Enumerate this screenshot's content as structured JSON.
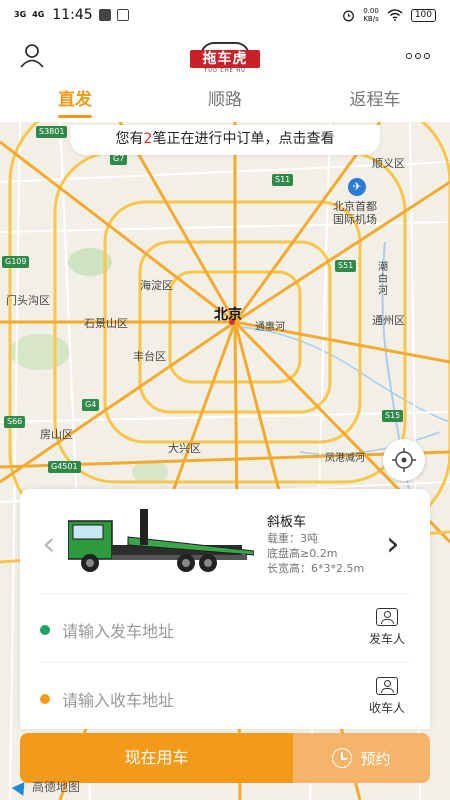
{
  "status_bar": {
    "signal_1": "3G",
    "signal_2": "4G",
    "time": "11:45",
    "net_speed_value": "0.00",
    "net_speed_unit": "KB/s",
    "battery": "100"
  },
  "header": {
    "logo_text": "拖车虎",
    "logo_sub": "TUO CHE HU",
    "user_icon": "user-icon",
    "more_icon": "more-icon"
  },
  "tabs": [
    {
      "label": "直发",
      "active": true
    },
    {
      "label": "顺路",
      "active": false
    },
    {
      "label": "返程车",
      "active": false
    }
  ],
  "notice": {
    "prefix": "您有",
    "count": "2",
    "suffix": "笔正在进行中订单，点击查看"
  },
  "map": {
    "labels": {
      "beijing": "北京",
      "haidian": "海淀区",
      "shijingshan": "石景山区",
      "fengtai": "丰台区",
      "mentougou": "门头沟区",
      "fangshan": "房山区",
      "daxing": "大兴区",
      "tongzhou": "通州区",
      "shunyi": "顺义区",
      "airport": "北京首都\n国际机场",
      "tonghuihe": "通惠河",
      "chaobaihe": "潮白河",
      "fenggangjianhe": "凤港减河"
    },
    "road_tags": [
      "S3801",
      "G7",
      "S11",
      "G109",
      "S51",
      "G4",
      "S66",
      "G4501",
      "S15"
    ],
    "attribution": "高德地图"
  },
  "vehicle": {
    "name": "斜板车",
    "load": "载重：3吨",
    "chassis": "底盘高≥0.2m",
    "size": "长宽高：6*3*2.5m",
    "prev_arrow": "‹",
    "next_arrow": "›"
  },
  "departure": {
    "placeholder": "请输入发车地址",
    "person_label": "发车人",
    "dot_color": "#1aa35c"
  },
  "arrival": {
    "placeholder": "请输入收车地址",
    "person_label": "收车人",
    "dot_color": "#f29a1a"
  },
  "actions": {
    "now_label": "现在用车",
    "book_label": "预约"
  },
  "colors": {
    "accent": "#f29a1a",
    "accent_light": "#f5b46a",
    "notice_count": "#e2322b"
  }
}
